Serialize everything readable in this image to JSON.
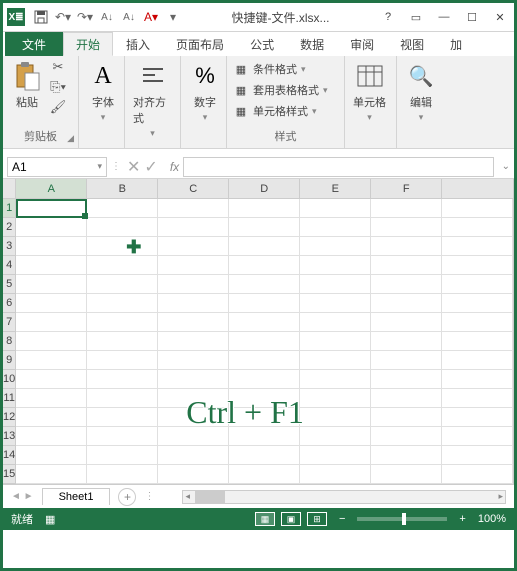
{
  "title": "快捷键-文件.xlsx...",
  "tabs": {
    "file": "文件",
    "home": "开始",
    "insert": "插入",
    "layout": "页面布局",
    "formulas": "公式",
    "data": "数据",
    "review": "审阅",
    "view": "视图",
    "addins": "加"
  },
  "groups": {
    "clipboard": {
      "label": "剪贴板",
      "paste": "粘贴"
    },
    "font": {
      "label": "字体"
    },
    "align": {
      "label": "对齐方式"
    },
    "number": {
      "label": "数字"
    },
    "styles": {
      "label": "样式",
      "cond": "条件格式",
      "table": "套用表格格式",
      "cell": "单元格样式"
    },
    "cells": {
      "label": "单元格"
    },
    "edit": {
      "label": "编辑"
    }
  },
  "namebox": "A1",
  "watermark": "Ctrl + F1",
  "columns": [
    "A",
    "B",
    "C",
    "D",
    "E",
    "F"
  ],
  "rows": [
    "1",
    "2",
    "3",
    "4",
    "5",
    "6",
    "7",
    "8",
    "9",
    "10",
    "11",
    "12",
    "13",
    "14",
    "15"
  ],
  "sheet": "Sheet1",
  "status": "就绪",
  "zoom": "100%"
}
